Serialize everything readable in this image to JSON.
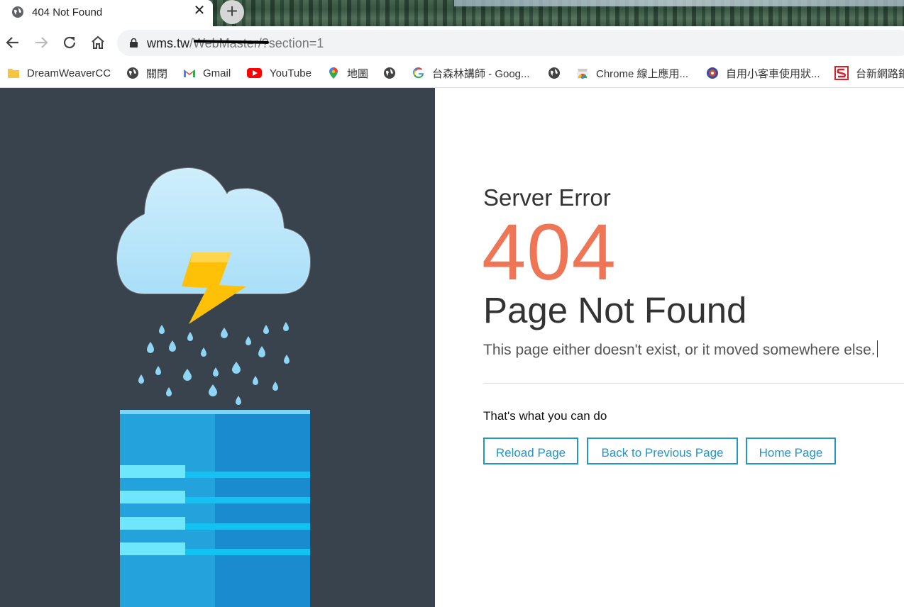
{
  "browser": {
    "tab": {
      "title": "404 Not Found",
      "favicon": "globe-icon",
      "close": "✕"
    },
    "new_tab": "+",
    "omnibox": {
      "host": "wms.tw",
      "path_redacted": "/WebMaster/",
      "query": "?section=1"
    },
    "bookmarks": [
      {
        "label": "DreamWeaverCC",
        "icon": "folder-icon"
      },
      {
        "label": "關閉",
        "icon": "globe-icon"
      },
      {
        "label": "Gmail",
        "icon": "gmail-icon"
      },
      {
        "label": "YouTube",
        "icon": "youtube-icon"
      },
      {
        "label": "地圖",
        "icon": "maps-icon"
      },
      {
        "label": "",
        "icon": "globe-icon"
      },
      {
        "label": "台森林講師 - Goog...",
        "icon": "google-icon"
      },
      {
        "label": "",
        "icon": "globe-icon"
      },
      {
        "label": "Chrome 線上應用...",
        "icon": "chrome-webstore-icon"
      },
      {
        "label": "自用小客車使用狀...",
        "icon": "emblem-icon"
      },
      {
        "label": "台新網路銀",
        "icon": "taishin-icon"
      }
    ]
  },
  "page": {
    "heading": "Server Error",
    "code": "404",
    "title": "Page Not Found",
    "description": "This page either doesn't exist, or it moved somewhere else.",
    "actions_heading": "That's what you can do",
    "buttons": [
      "Reload Page",
      "Back to Previous Page",
      "Home Page"
    ]
  },
  "colors": {
    "left_pane": "#39434e",
    "accent_404": "#ef7557",
    "button_blue": "#2196c8"
  }
}
